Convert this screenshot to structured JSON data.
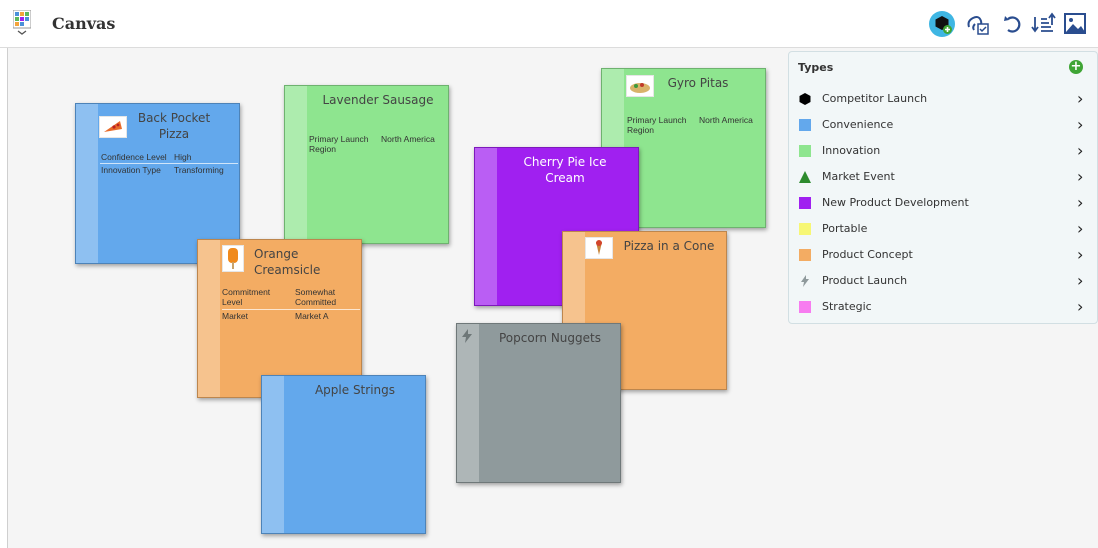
{
  "header": {
    "title": "Canvas"
  },
  "cards": {
    "back_pocket": {
      "title": "Back Pocket Pizza",
      "props": [
        {
          "label": "Confidence Level",
          "value": "High"
        },
        {
          "label": "Innovation Type",
          "value": "Transforming"
        }
      ]
    },
    "lavender": {
      "title": "Lavender Sausage",
      "props": [
        {
          "label": "Primary Launch Region",
          "value": "North America"
        }
      ]
    },
    "gyro": {
      "title": "Gyro Pitas",
      "props": [
        {
          "label": "Primary Launch Region",
          "value": "North America"
        }
      ]
    },
    "cherry": {
      "title": "Cherry Pie Ice Cream"
    },
    "orange": {
      "title": "Orange Creamsicle",
      "props": [
        {
          "label": "Commitment Level",
          "value": "Somewhat Committed"
        },
        {
          "label": "Market",
          "value": "Market A"
        }
      ]
    },
    "pizza_cone": {
      "title": "Pizza in a Cone"
    },
    "popcorn": {
      "title": "Popcorn Nuggets"
    },
    "apple": {
      "title": "Apple Strings"
    }
  },
  "types_panel": {
    "title": "Types",
    "items": [
      {
        "label": "Competitor Launch",
        "swatch": "#000000",
        "shape": "hexagon"
      },
      {
        "label": "Convenience",
        "swatch": "#63a8ec",
        "shape": "square"
      },
      {
        "label": "Innovation",
        "swatch": "#8ee58f",
        "shape": "square"
      },
      {
        "label": "Market Event",
        "swatch": "#2e8b2e",
        "shape": "triangle"
      },
      {
        "label": "New Product Development",
        "swatch": "#a020f0",
        "shape": "square"
      },
      {
        "label": "Portable",
        "swatch": "#f7f775",
        "shape": "square"
      },
      {
        "label": "Product Concept",
        "swatch": "#f3ac63",
        "shape": "square"
      },
      {
        "label": "Product Launch",
        "swatch": "#8f9a9c",
        "shape": "lightning-icon"
      },
      {
        "label": "Strategic",
        "swatch": "#f77cf0",
        "shape": "square"
      }
    ]
  }
}
